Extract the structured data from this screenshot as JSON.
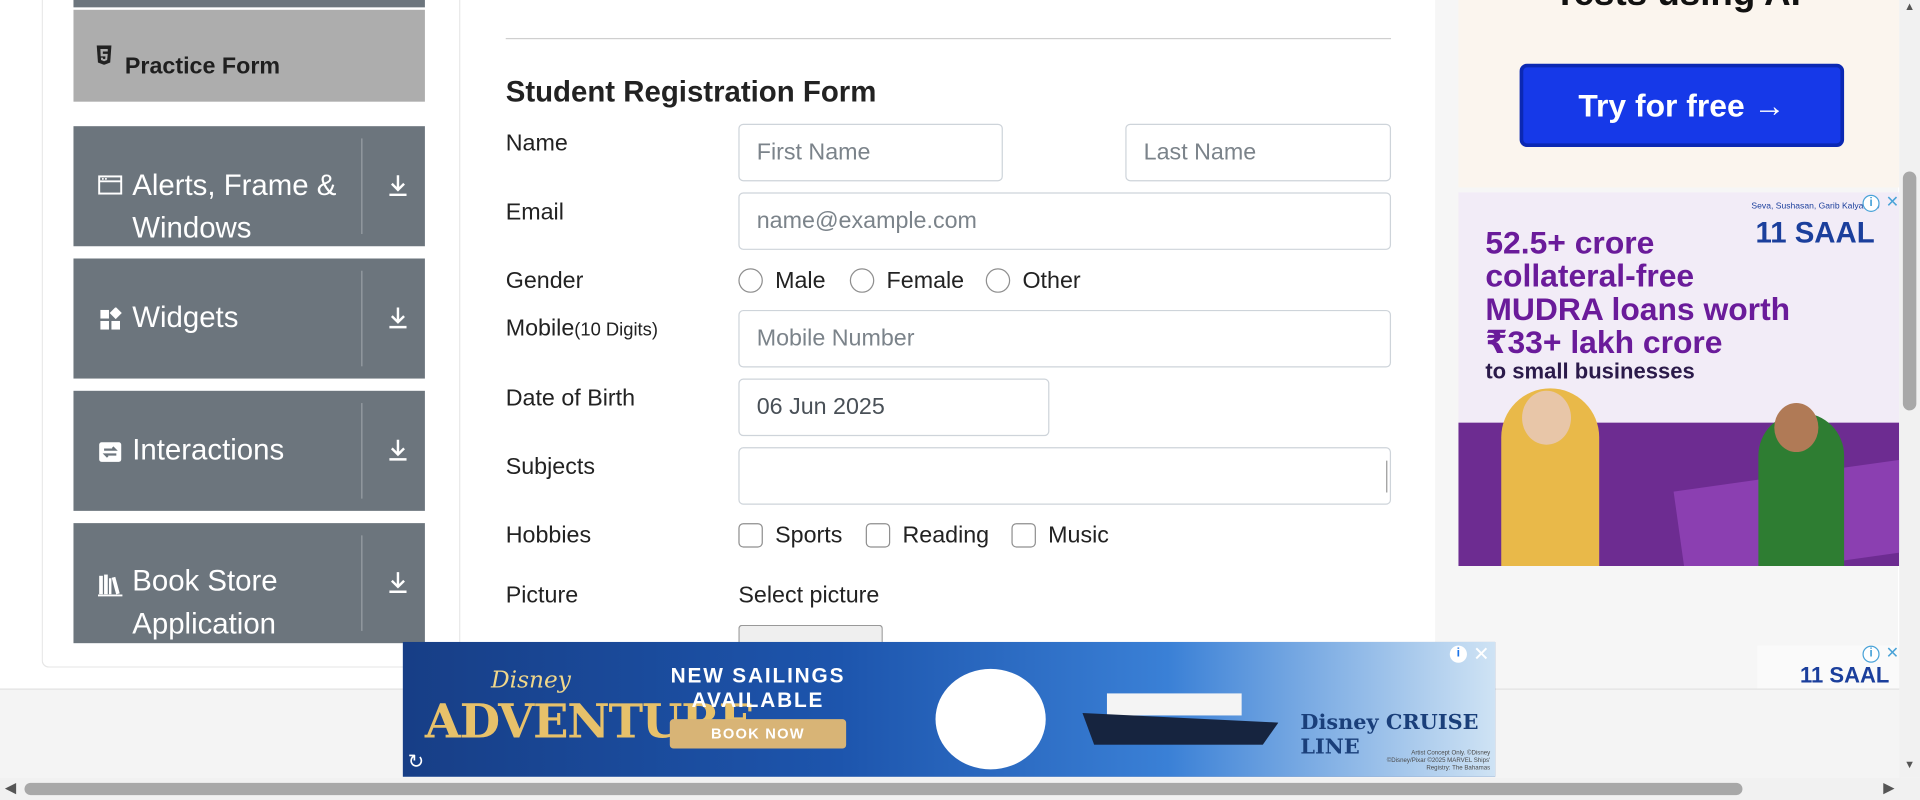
{
  "sidebar": {
    "practice_form": "Practice Form",
    "groups": [
      {
        "label": "Alerts, Frame & Windows"
      },
      {
        "label": "Widgets"
      },
      {
        "label": "Interactions"
      },
      {
        "label": "Book Store Application"
      }
    ]
  },
  "form": {
    "title": "Student Registration Form",
    "name_label": "Name",
    "first_name_placeholder": "First Name",
    "last_name_placeholder": "Last Name",
    "email_label": "Email",
    "email_placeholder": "name@example.com",
    "gender_label": "Gender",
    "genders": [
      "Male",
      "Female",
      "Other"
    ],
    "mobile_label": "Mobile",
    "mobile_hint": "(10 Digits)",
    "mobile_placeholder": "Mobile Number",
    "dob_label": "Date of Birth",
    "dob_value": "06 Jun 2025",
    "subjects_label": "Subjects",
    "hobbies_label": "Hobbies",
    "hobbies": [
      "Sports",
      "Reading",
      "Music"
    ],
    "picture_label": "Picture",
    "select_picture": "Select picture"
  },
  "ads": {
    "top_tagline": "Tests using AI",
    "try_button": "Try for free →",
    "mudra_title": "52.5+ crore collateral-free MUDRA loans worth ₹33+ lakh crore",
    "mudra_sub": "to small businesses",
    "saal_logo": "11 SAAL",
    "saal_sub": "Seva, Sushasan, Garib Kalyan ke",
    "banner": {
      "disney": "Disney",
      "adventure": "ADVENTURE",
      "new_sailings": "NEW SAILINGS AVAILABLE",
      "book_now": "BOOK NOW",
      "cruise_line": "Disney CRUISE LINE",
      "fine_print": "Artist Concept Only. ©Disney ©Disney/Pixar ©2025 MARVEL Ships' Registry: The Bahamas"
    }
  },
  "colors": {
    "sidebar_group": "#6c757d",
    "practice_active": "#adadad",
    "try_button": "#1639e8",
    "mudra_purple": "#6a1b9a",
    "banner_blue": "#1d4e9e"
  }
}
